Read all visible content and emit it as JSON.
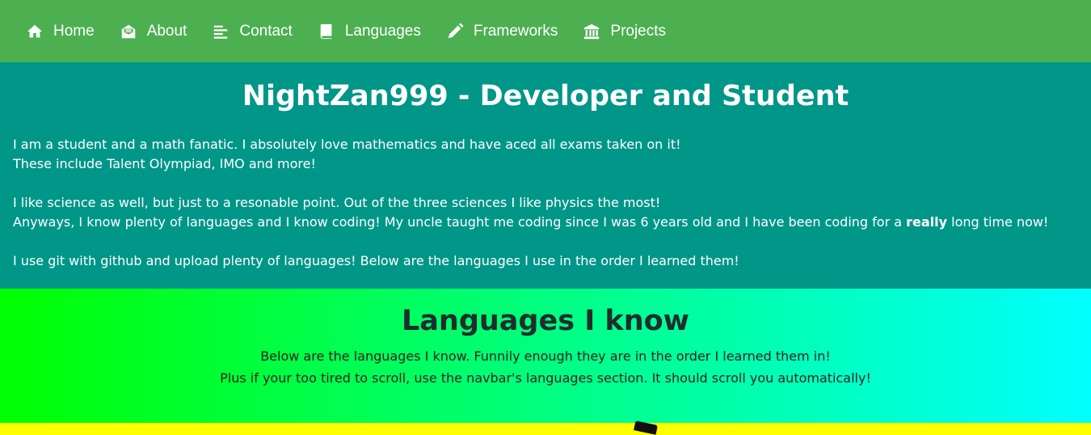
{
  "navbar": {
    "items": [
      {
        "label": "Home",
        "icon": "home-icon"
      },
      {
        "label": "About",
        "icon": "envelope-open-icon"
      },
      {
        "label": "Contact",
        "icon": "align-left-icon"
      },
      {
        "label": "Languages",
        "icon": "book-icon"
      },
      {
        "label": "Frameworks",
        "icon": "pencil-icon"
      },
      {
        "label": "Projects",
        "icon": "university-icon"
      }
    ],
    "background": "#4caf50"
  },
  "about": {
    "title": "NightZan999 - Developer and Student",
    "p1_line1": "I am a student and a math fanatic. I absolutely love mathematics and have aced all exams taken on it!",
    "p1_line2": "These include Talent Olympiad, IMO and more!",
    "p2_line1": "I like science as well, but just to a resonable point. Out of the three sciences I like physics the most!",
    "p2_line2_before": "Anyways, I know plenty of languages and I know coding! My uncle taught me coding since I was 6 years old and I have been coding for a ",
    "p2_line2_bold": "really",
    "p2_line2_after": " long time now!",
    "p3": "I use git with github and upload plenty of languages! Below are the languages I use in the order I learned them!",
    "background": "#009688"
  },
  "languages": {
    "title": "Languages I know",
    "line1": "Below are the languages I know. Funnily enough they are in the order I learned them in!",
    "line2": "Plus if your too tired to scroll, use the navbar's languages section. It should scroll you automatically!",
    "gradient_start": "#00ff00",
    "gradient_end": "#00ffff"
  }
}
